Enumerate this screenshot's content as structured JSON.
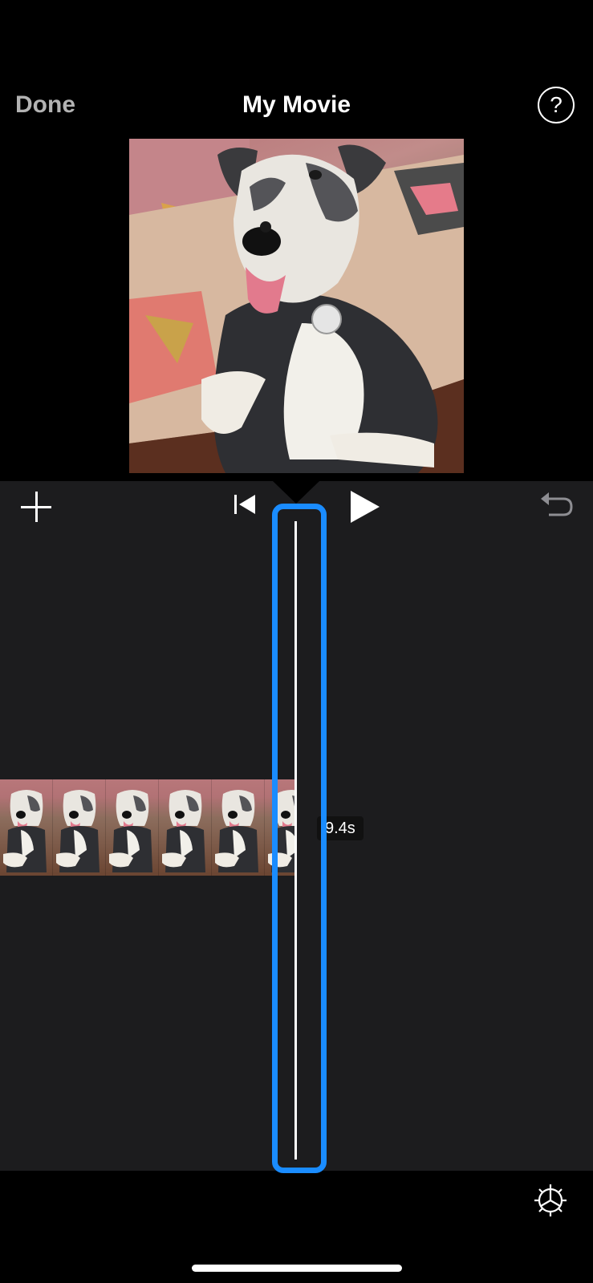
{
  "header": {
    "done_label": "Done",
    "title": "My Movie",
    "help_label": "?"
  },
  "timeline": {
    "time_label": "9.4s",
    "frame_count": 6
  },
  "colors": {
    "accent": "#1a8cff",
    "panel": "#1c1c1e",
    "done_text": "#b3b3b3"
  },
  "icons": {
    "add": "plus-icon",
    "skip_back": "skip-to-start-icon",
    "play": "play-icon",
    "undo": "undo-icon",
    "settings": "gear-icon",
    "help": "question-mark-icon"
  }
}
